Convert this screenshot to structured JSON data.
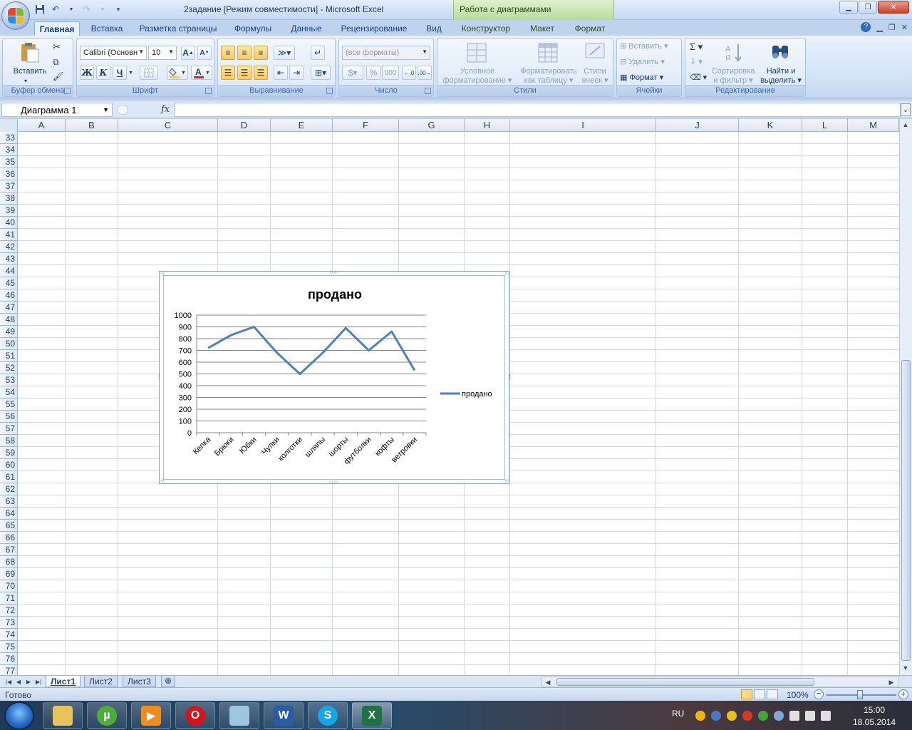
{
  "window": {
    "title": "2задание  [Режим совместимости] - Microsoft Excel",
    "context_title": "Работа с диаграммами"
  },
  "tabs": [
    {
      "label": "Главная",
      "active": true
    },
    {
      "label": "Вставка"
    },
    {
      "label": "Разметка страницы"
    },
    {
      "label": "Формулы"
    },
    {
      "label": "Данные"
    },
    {
      "label": "Рецензирование"
    },
    {
      "label": "Вид"
    },
    {
      "label": "Конструктор",
      "context": true
    },
    {
      "label": "Макет",
      "context": true
    },
    {
      "label": "Формат",
      "context": true
    }
  ],
  "ribbon": {
    "clipboard": {
      "label": "Буфер обмена",
      "paste": "Вставить"
    },
    "font": {
      "label": "Шрифт",
      "font_name": "Calibri (Основн",
      "font_size": "10",
      "bold": "Ж",
      "italic": "К",
      "underline": "Ч"
    },
    "alignment": {
      "label": "Выравнивание"
    },
    "number": {
      "label": "Число",
      "format": "(все форматы)",
      "percent": "%",
      "thousands": "000"
    },
    "styles": {
      "label": "Стили",
      "conditional_1": "Условное",
      "conditional_2": "форматирование",
      "as_table_1": "Форматировать",
      "as_table_2": "как таблицу",
      "cell_styles_1": "Стили",
      "cell_styles_2": "ячеек"
    },
    "cells": {
      "label": "Ячейки",
      "insert": "Вставить",
      "delete": "Удалить",
      "format": "Формат"
    },
    "editing": {
      "label": "Редактирование",
      "sum": "Σ",
      "sort_1": "Сортировка",
      "sort_2": "и фильтр",
      "find_1": "Найти и",
      "find_2": "выделить"
    }
  },
  "formula_bar": {
    "name_box": "Диаграмма 1",
    "fx": "fx",
    "value": ""
  },
  "columns": [
    "A",
    "B",
    "C",
    "D",
    "E",
    "F",
    "G",
    "H",
    "I",
    "J",
    "K",
    "L",
    "M"
  ],
  "rows": [
    "33",
    "34",
    "35",
    "36",
    "37",
    "38",
    "39",
    "40",
    "41",
    "42",
    "43",
    "44",
    "45",
    "46",
    "47",
    "48",
    "49",
    "50",
    "51",
    "52",
    "53",
    "54",
    "55",
    "56",
    "57",
    "58",
    "59",
    "60",
    "61",
    "62",
    "63",
    "64",
    "65",
    "66",
    "67",
    "68",
    "69",
    "70",
    "71",
    "72",
    "73",
    "74",
    "75",
    "76",
    "77"
  ],
  "sheets": [
    {
      "name": "Лист1",
      "active": true
    },
    {
      "name": "Лист2"
    },
    {
      "name": "Лист3"
    }
  ],
  "status": {
    "ready": "Готово",
    "zoom": "100%"
  },
  "taskbar": {
    "lang": "RU",
    "time": "15:00",
    "date": "18.05.2014"
  },
  "colors": {
    "series": "#4f81bd",
    "ribbon_text": "#15428b"
  },
  "chart_data": {
    "type": "line",
    "title": "продано",
    "categories": [
      "Кепка",
      "Брюки",
      "Юбки",
      "Чулки",
      "колготки",
      "шляпы",
      "шорты",
      "футболки",
      "кофты",
      "ветровки"
    ],
    "series": [
      {
        "name": "продано",
        "values": [
          720,
          830,
          900,
          680,
          500,
          680,
          890,
          700,
          860,
          530
        ]
      }
    ],
    "ylim": [
      0,
      1000
    ],
    "yticks": [
      0,
      100,
      200,
      300,
      400,
      500,
      600,
      700,
      800,
      900,
      1000
    ],
    "grid": true,
    "legend": "right",
    "xlabel": "",
    "ylabel": ""
  }
}
